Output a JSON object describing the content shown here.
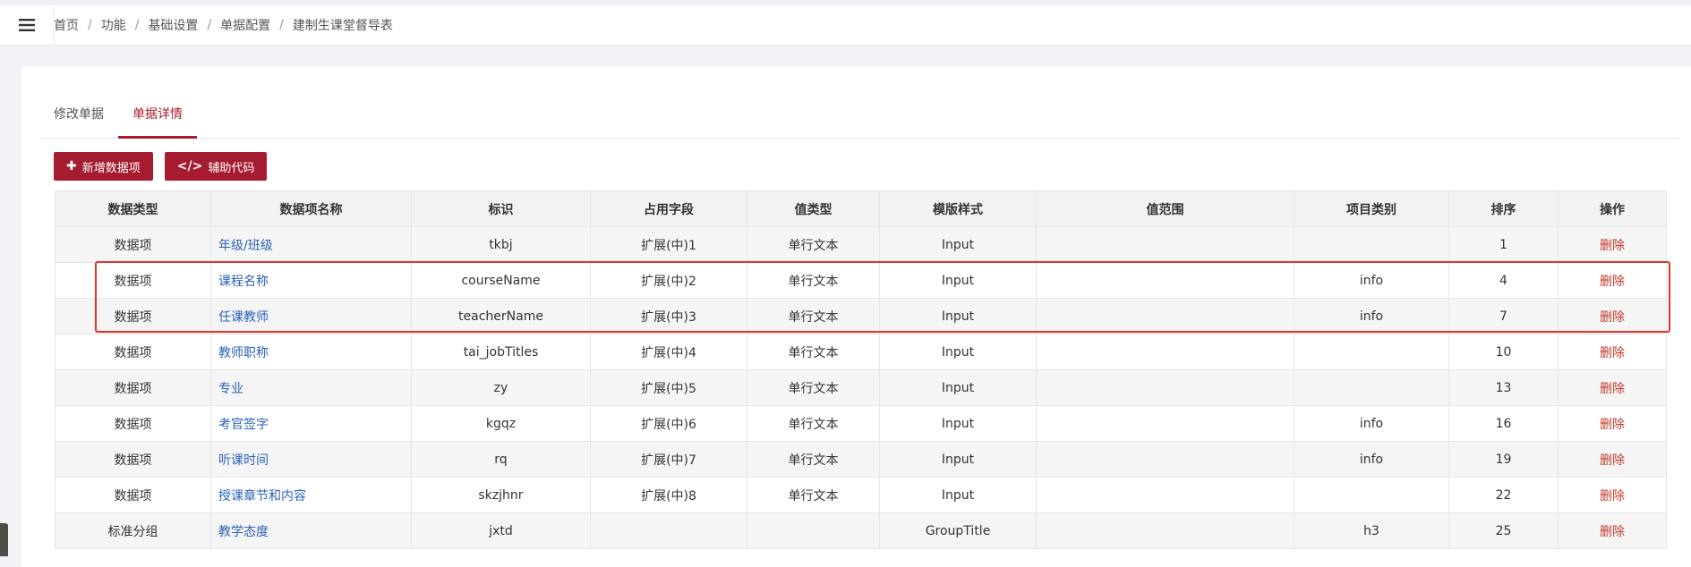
{
  "breadcrumb": [
    "首页",
    "功能",
    "基础设置",
    "单据配置",
    "建制生课堂督导表"
  ],
  "breadcrumb_separator": "/",
  "tabs": [
    {
      "label": "修改单据",
      "active": false
    },
    {
      "label": "单据详情",
      "active": true
    }
  ],
  "toolbar": {
    "add_label": "新增数据项",
    "add_icon": "plus-icon",
    "code_label": "辅助代码",
    "code_icon": "code-icon"
  },
  "table": {
    "headers": [
      "数据类型",
      "数据项名称",
      "标识",
      "占用字段",
      "值类型",
      "模版样式",
      "值范围",
      "项目类别",
      "排序",
      "操作"
    ],
    "rows": [
      {
        "type": "数据项",
        "name": "年级/班级",
        "id": "tkbj",
        "field": "扩展(中)1",
        "vtype": "单行文本",
        "style": "Input",
        "range": "",
        "category": "",
        "order": "1",
        "op": "删除"
      },
      {
        "type": "数据项",
        "name": "课程名称",
        "id": "courseName",
        "field": "扩展(中)2",
        "vtype": "单行文本",
        "style": "Input",
        "range": "",
        "category": "info",
        "order": "4",
        "op": "删除"
      },
      {
        "type": "数据项",
        "name": "任课教师",
        "id": "teacherName",
        "field": "扩展(中)3",
        "vtype": "单行文本",
        "style": "Input",
        "range": "",
        "category": "info",
        "order": "7",
        "op": "删除"
      },
      {
        "type": "数据项",
        "name": "教师职称",
        "id": "tai_jobTitles",
        "field": "扩展(中)4",
        "vtype": "单行文本",
        "style": "Input",
        "range": "",
        "category": "",
        "order": "10",
        "op": "删除"
      },
      {
        "type": "数据项",
        "name": "专业",
        "id": "zy",
        "field": "扩展(中)5",
        "vtype": "单行文本",
        "style": "Input",
        "range": "",
        "category": "",
        "order": "13",
        "op": "删除"
      },
      {
        "type": "数据项",
        "name": "考官签字",
        "id": "kgqz",
        "field": "扩展(中)6",
        "vtype": "单行文本",
        "style": "Input",
        "range": "",
        "category": "info",
        "order": "16",
        "op": "删除"
      },
      {
        "type": "数据项",
        "name": "听课时间",
        "id": "rq",
        "field": "扩展(中)7",
        "vtype": "单行文本",
        "style": "Input",
        "range": "",
        "category": "info",
        "order": "19",
        "op": "删除"
      },
      {
        "type": "数据项",
        "name": "授课章节和内容",
        "id": "skzjhnr",
        "field": "扩展(中)8",
        "vtype": "单行文本",
        "style": "Input",
        "range": "",
        "category": "",
        "order": "22",
        "op": "删除"
      },
      {
        "type": "标准分组",
        "name": "教学态度",
        "id": "jxtd",
        "field": "",
        "vtype": "",
        "style": "GroupTitle",
        "range": "",
        "category": "h3",
        "order": "25",
        "op": "删除"
      }
    ]
  },
  "colors": {
    "accent": "#a51c30",
    "link": "#2b62b9",
    "delete": "#c0392b",
    "highlight": "#e5312d"
  }
}
